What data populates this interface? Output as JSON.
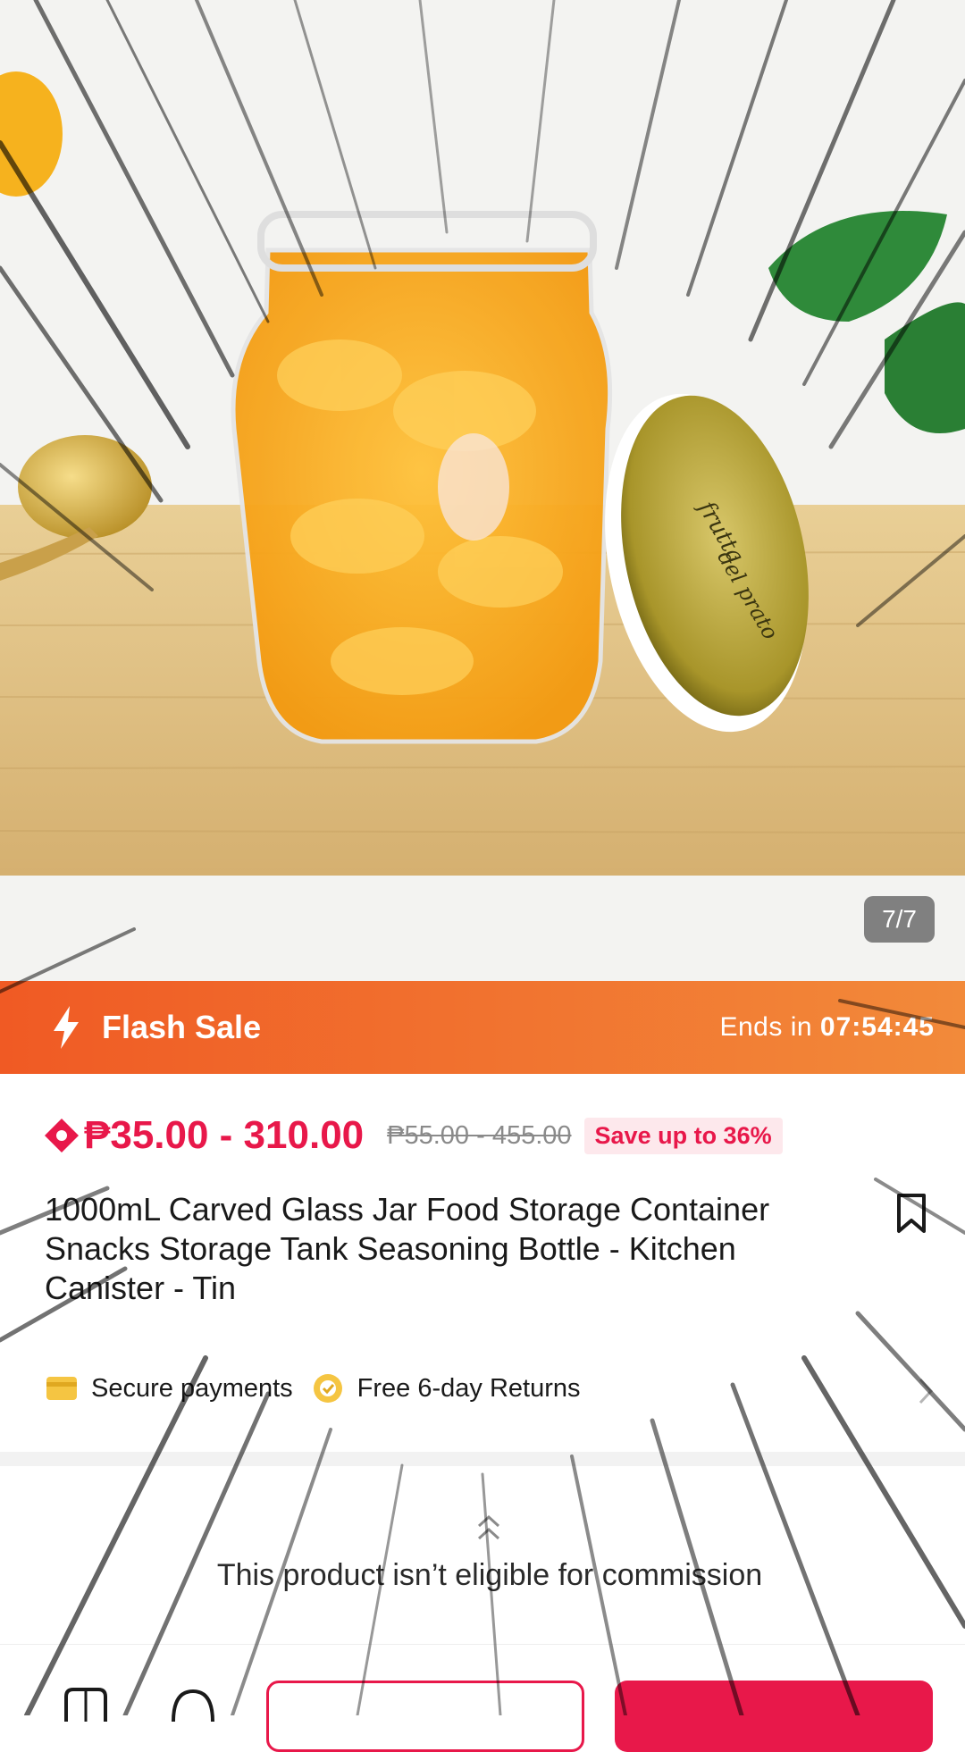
{
  "gallery": {
    "counter": "7/7",
    "lid_text_1": "frutta",
    "lid_text_2": "del prato"
  },
  "flash_sale": {
    "label": "Flash Sale",
    "ends_prefix": "Ends in",
    "countdown": "07:54:45"
  },
  "price": {
    "current": "₱35.00 - 310.00",
    "original": "₱55.00 - 455.00",
    "save": "Save up to 36%"
  },
  "product": {
    "title": "1000mL Carved Glass Jar Food Storage Container Snacks Storage Tank Seasoning Bottle - Kitchen Canister - Tin"
  },
  "assurances": {
    "secure": "Secure payments",
    "returns": "Free 6-day Returns"
  },
  "commission": {
    "message": "This product isn’t eligible for commission"
  },
  "colors": {
    "accent": "#e8184a",
    "flash_start": "#f05a24",
    "flash_end": "#f28a3a"
  },
  "icons": [
    "bolt-icon",
    "price-tag-icon",
    "bookmark-icon",
    "card-icon",
    "return-badge-icon",
    "chevron-right-icon",
    "chevron-up-double-icon",
    "shop-icon",
    "chat-icon"
  ]
}
